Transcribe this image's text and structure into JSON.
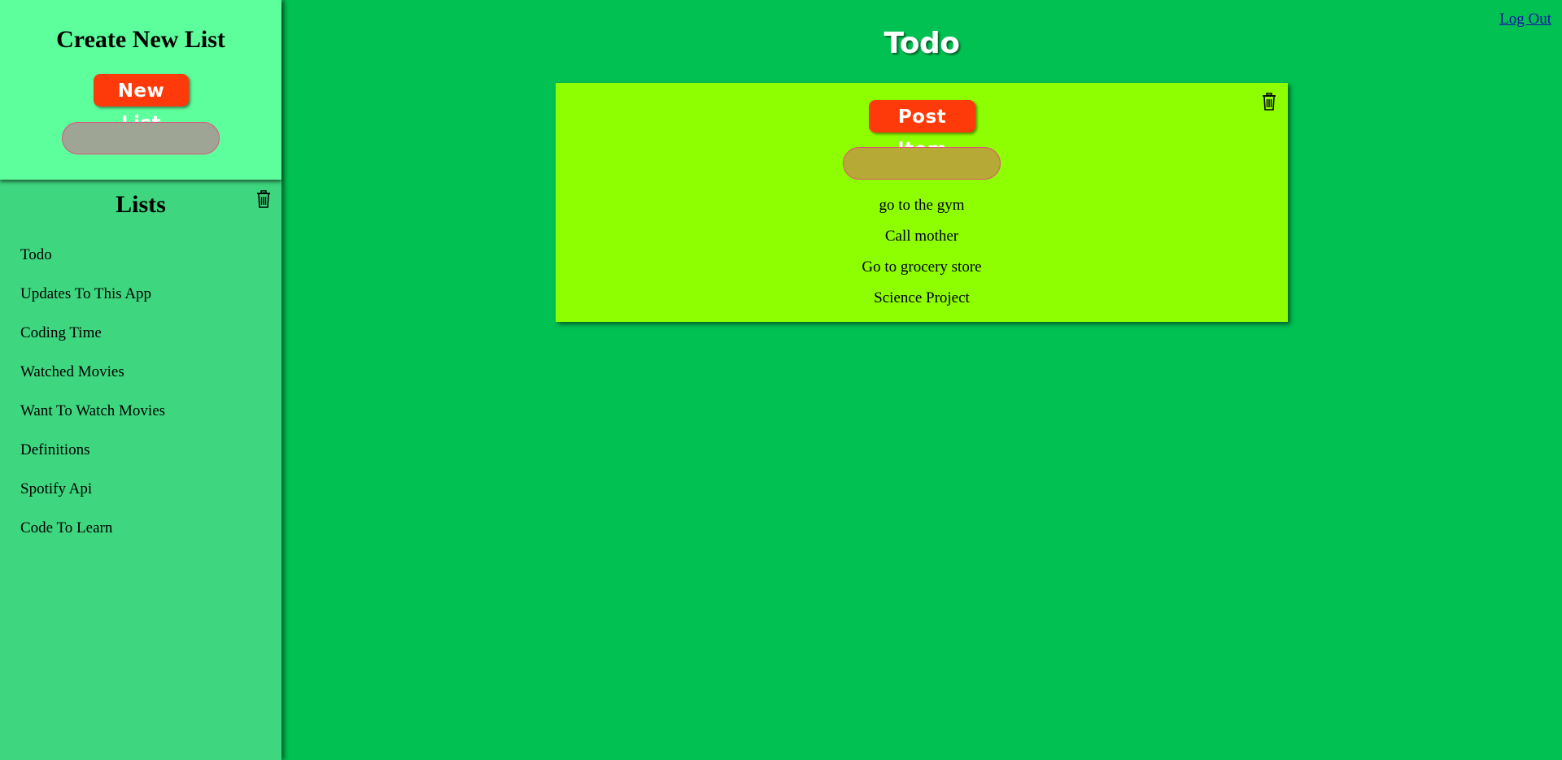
{
  "sidebar": {
    "create_title": "Create New List",
    "new_list_label": "New List",
    "new_list_input_value": "",
    "lists_title": "Lists",
    "items": [
      {
        "label": "Todo"
      },
      {
        "label": "Updates To This App"
      },
      {
        "label": "Coding Time"
      },
      {
        "label": "Watched Movies"
      },
      {
        "label": "Want To Watch Movies"
      },
      {
        "label": "Definitions"
      },
      {
        "label": "Spotify Api"
      },
      {
        "label": "Code To Learn"
      }
    ]
  },
  "header": {
    "logout_label": "Log Out",
    "title": "Todo"
  },
  "card": {
    "post_label": "Post Item",
    "item_input_value": "",
    "items": [
      {
        "label": "go to the gym"
      },
      {
        "label": "Call mother"
      },
      {
        "label": "Go to grocery store"
      },
      {
        "label": "Science Project"
      }
    ]
  },
  "colors": {
    "background": "#00c152",
    "sidebar": "#3ed67f",
    "create_panel": "#5dfe9c",
    "card": "#8eff00",
    "button": "#ff3a0a"
  },
  "icons": {
    "trash": "trash-icon"
  }
}
